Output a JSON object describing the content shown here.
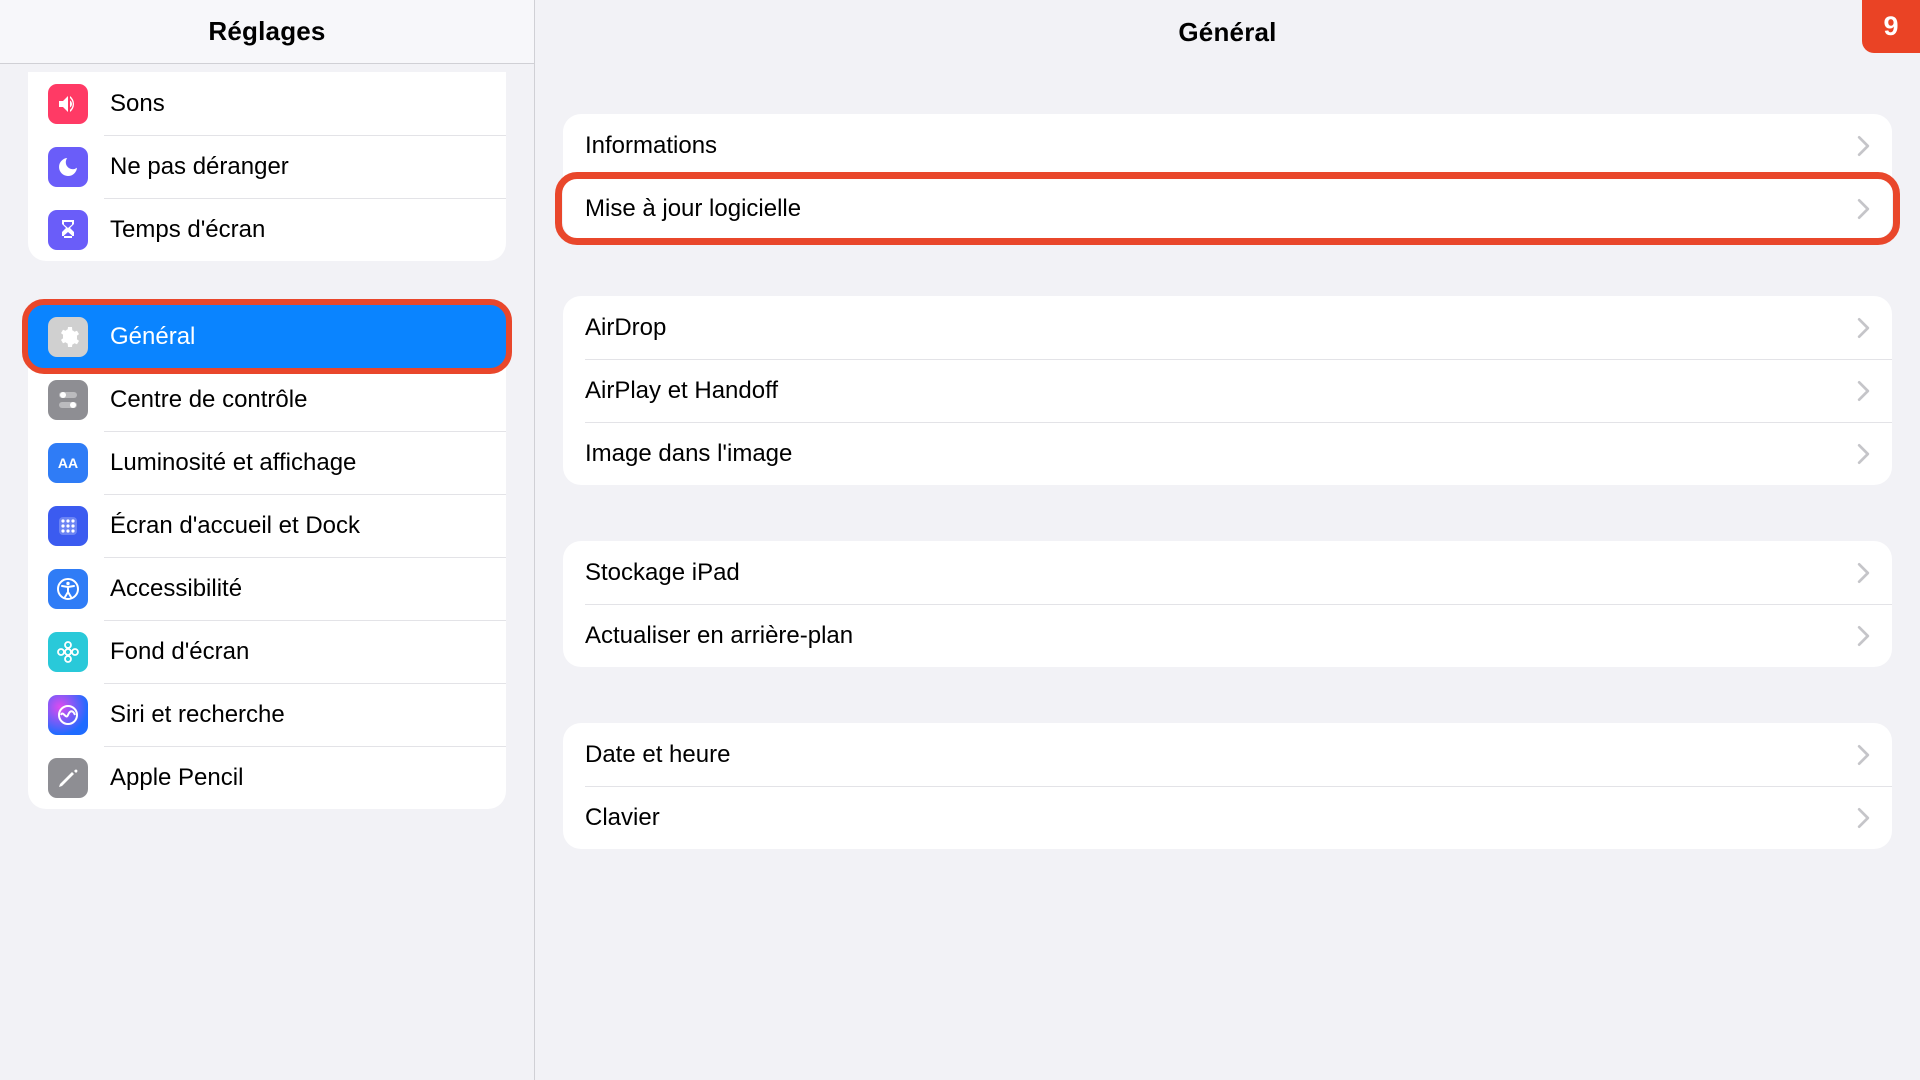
{
  "step_badge": "9",
  "sidebar": {
    "title": "Réglages",
    "groups": [
      {
        "items": [
          {
            "key": "sounds",
            "label": "Sons",
            "icon": "sound-icon",
            "selected": false
          },
          {
            "key": "dnd",
            "label": "Ne pas déranger",
            "icon": "dnd-icon",
            "selected": false
          },
          {
            "key": "screen-time",
            "label": "Temps d'écran",
            "icon": "screentime-icon",
            "selected": false
          }
        ]
      },
      {
        "items": [
          {
            "key": "general",
            "label": "Général",
            "icon": "gear-icon",
            "selected": true,
            "highlighted": true
          },
          {
            "key": "control-center",
            "label": "Centre de contrôle",
            "icon": "cc-icon",
            "selected": false
          },
          {
            "key": "display",
            "label": "Luminosité et affichage",
            "icon": "display-icon",
            "selected": false
          },
          {
            "key": "home-dock",
            "label": "Écran d'accueil et Dock",
            "icon": "home-icon",
            "selected": false
          },
          {
            "key": "accessibility",
            "label": "Accessibilité",
            "icon": "access-icon",
            "selected": false
          },
          {
            "key": "wallpaper",
            "label": "Fond d'écran",
            "icon": "wallpaper-icon",
            "selected": false
          },
          {
            "key": "siri",
            "label": "Siri et recherche",
            "icon": "siri-icon",
            "selected": false
          },
          {
            "key": "apple-pencil",
            "label": "Apple Pencil",
            "icon": "pencil-icon",
            "selected": false
          }
        ]
      }
    ]
  },
  "detail": {
    "title": "Général",
    "groups": [
      [
        {
          "key": "about",
          "label": "Informations",
          "highlighted": false
        },
        {
          "key": "software-update",
          "label": "Mise à jour logicielle",
          "highlighted": true
        }
      ],
      [
        {
          "key": "airdrop",
          "label": "AirDrop"
        },
        {
          "key": "airplay",
          "label": "AirPlay et Handoff"
        },
        {
          "key": "pip",
          "label": "Image dans l'image"
        }
      ],
      [
        {
          "key": "storage",
          "label": "Stockage iPad"
        },
        {
          "key": "bg-refresh",
          "label": "Actualiser en arrière-plan"
        }
      ],
      [
        {
          "key": "date-time",
          "label": "Date et heure"
        },
        {
          "key": "keyboard",
          "label": "Clavier"
        }
      ]
    ]
  }
}
